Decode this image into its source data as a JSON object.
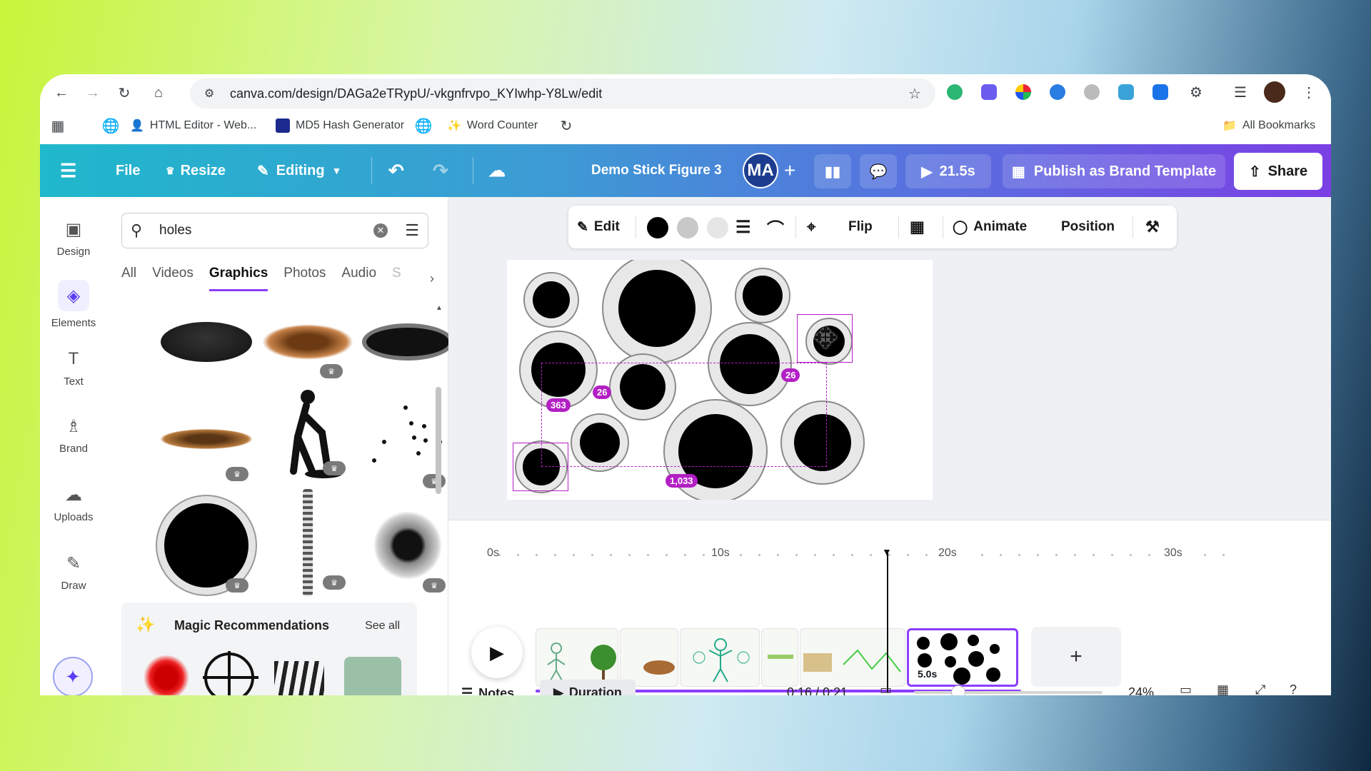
{
  "browser": {
    "url": "canva.com/design/DAGa2eTRypU/-vkgnfrvpo_KYIwhp-Y8Lw/edit",
    "bookmarks": [
      {
        "label": "HTML Editor - Web..."
      },
      {
        "label": "MD5 Hash Generator"
      },
      {
        "label": "Word Counter"
      }
    ],
    "all_bookmarks": "All Bookmarks"
  },
  "topbar": {
    "file": "File",
    "resize": "Resize",
    "editing": "Editing",
    "title": "Demo Stick Figure 3",
    "avatar": "MA",
    "play_duration": "21.5s",
    "publish": "Publish as Brand Template",
    "share": "Share"
  },
  "rail": [
    {
      "label": "Design",
      "icon": "design-icon"
    },
    {
      "label": "Elements",
      "icon": "elements-icon"
    },
    {
      "label": "Text",
      "icon": "text-icon"
    },
    {
      "label": "Brand",
      "icon": "brand-icon"
    },
    {
      "label": "Uploads",
      "icon": "uploads-icon"
    },
    {
      "label": "Draw",
      "icon": "draw-icon"
    }
  ],
  "panel": {
    "search_value": "holes",
    "tabs": [
      "All",
      "Videos",
      "Graphics",
      "Photos",
      "Audio",
      "S"
    ],
    "active_tab": "Graphics",
    "magic_title": "Magic Recommendations",
    "see_all": "See all"
  },
  "toolbar": {
    "edit": "Edit",
    "flip": "Flip",
    "animate": "Animate",
    "position": "Position",
    "colors": [
      "#000000",
      "#c8c8c8",
      "#e6e6e6"
    ]
  },
  "canvas": {
    "measure_labels": [
      "363",
      "26",
      "26",
      "1,033"
    ]
  },
  "timeline": {
    "ticks": [
      "0s",
      "10s",
      "20s",
      "30s"
    ],
    "selected_clip_duration": "5.0s",
    "notes": "Notes",
    "duration": "Duration",
    "time": "0:16 / 0:21",
    "zoom": "24%"
  },
  "colors": {
    "accent": "#8b3dff",
    "measure": "#b31fc4"
  }
}
